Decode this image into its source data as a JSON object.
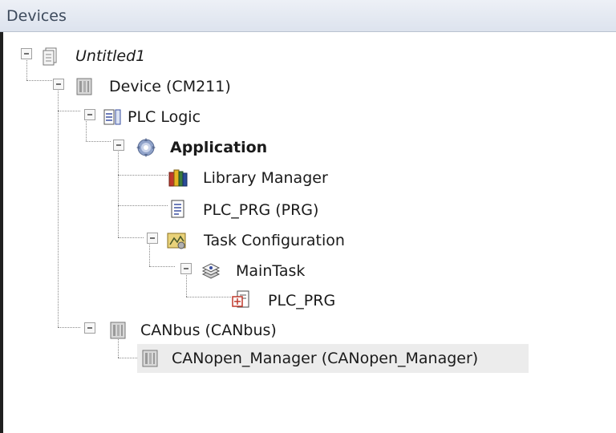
{
  "panel": {
    "title": "Devices"
  },
  "tree": {
    "project": {
      "label": "Untitled1",
      "icon": "project-file-icon"
    },
    "device": {
      "label": "Device (CM211)",
      "icon": "device-module-icon"
    },
    "plc_logic": {
      "label": "PLC Logic",
      "icon": "plc-logic-icon"
    },
    "application": {
      "label": "Application",
      "icon": "application-gear-icon"
    },
    "library_manager": {
      "label": "Library Manager",
      "icon": "library-books-icon"
    },
    "plc_prg": {
      "label": "PLC_PRG (PRG)",
      "icon": "program-document-icon"
    },
    "task_configuration": {
      "label": "Task Configuration",
      "icon": "task-configuration-icon"
    },
    "main_task": {
      "label": "MainTask",
      "icon": "task-stack-icon"
    },
    "plc_prg_call": {
      "label": "PLC_PRG",
      "icon": "program-call-icon"
    },
    "canbus": {
      "label": "CANbus (CANbus)",
      "icon": "device-module-icon"
    },
    "canopen_manager": {
      "label": "CANopen_Manager (CANopen_Manager)",
      "icon": "device-module-icon"
    }
  }
}
